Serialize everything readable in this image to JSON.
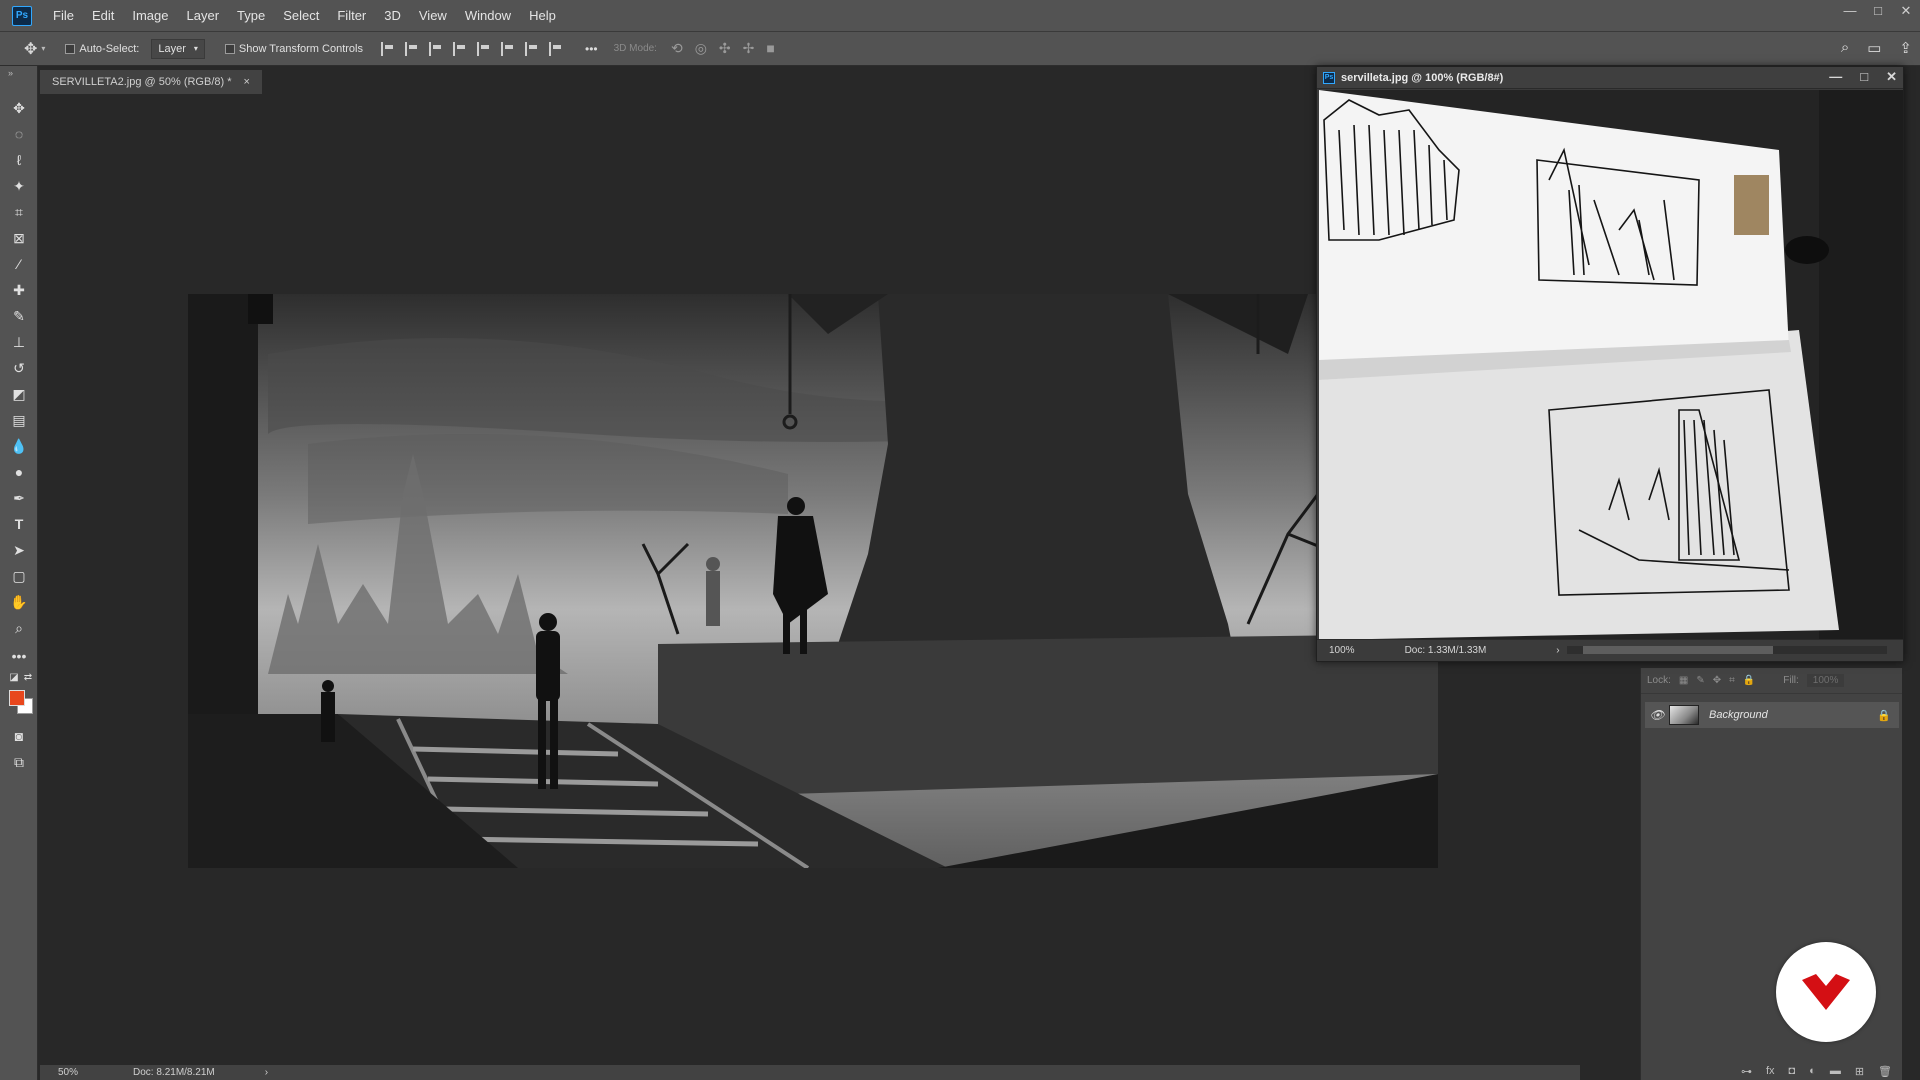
{
  "app": {
    "logo_text": "Ps"
  },
  "menu": [
    "File",
    "Edit",
    "Image",
    "Layer",
    "Type",
    "Select",
    "Filter",
    "3D",
    "View",
    "Window",
    "Help"
  ],
  "window_controls": {
    "minimize": "—",
    "maximize": "□",
    "close": "✕"
  },
  "options_bar": {
    "auto_select_label": "Auto-Select:",
    "auto_select_checked": false,
    "auto_select_target": "Layer",
    "show_transform_label": "Show Transform Controls",
    "show_transform_checked": false,
    "more_label": "•••",
    "mode_3d_label": "3D Mode:"
  },
  "document": {
    "tab_title": "SERVILLETA2.jpg @ 50% (RGB/8) *",
    "tab_close": "×",
    "zoom": "50%",
    "doc_size": "Doc: 8.21M/8.21M",
    "status_arrow": "›"
  },
  "floating_window": {
    "title": "servilleta.jpg @ 100% (RGB/8#)",
    "zoom": "100%",
    "doc_size": "Doc: 1.33M/1.33M",
    "status_arrow": "›"
  },
  "layers_panel": {
    "lock_label": "Lock:",
    "fill_label": "Fill:",
    "fill_value": "100%",
    "layers": [
      {
        "name": "Background",
        "visible": true,
        "locked": true
      }
    ]
  },
  "colors": {
    "foreground": "#e8471d",
    "background": "#ffffff",
    "accent": "#31a8ff",
    "watermark_red": "#d40f14"
  },
  "tools": [
    "move-icon",
    "marquee-icon",
    "lasso-icon",
    "magic-wand-icon",
    "crop-icon",
    "frame-icon",
    "eyedropper-icon",
    "healing-icon",
    "brush-icon",
    "stamp-icon",
    "history-brush-icon",
    "eraser-icon",
    "gradient-icon",
    "blur-icon",
    "dodge-icon",
    "pen-icon",
    "type-icon",
    "path-select-icon",
    "shape-icon",
    "hand-icon",
    "zoom-icon",
    "more-tools-icon"
  ]
}
